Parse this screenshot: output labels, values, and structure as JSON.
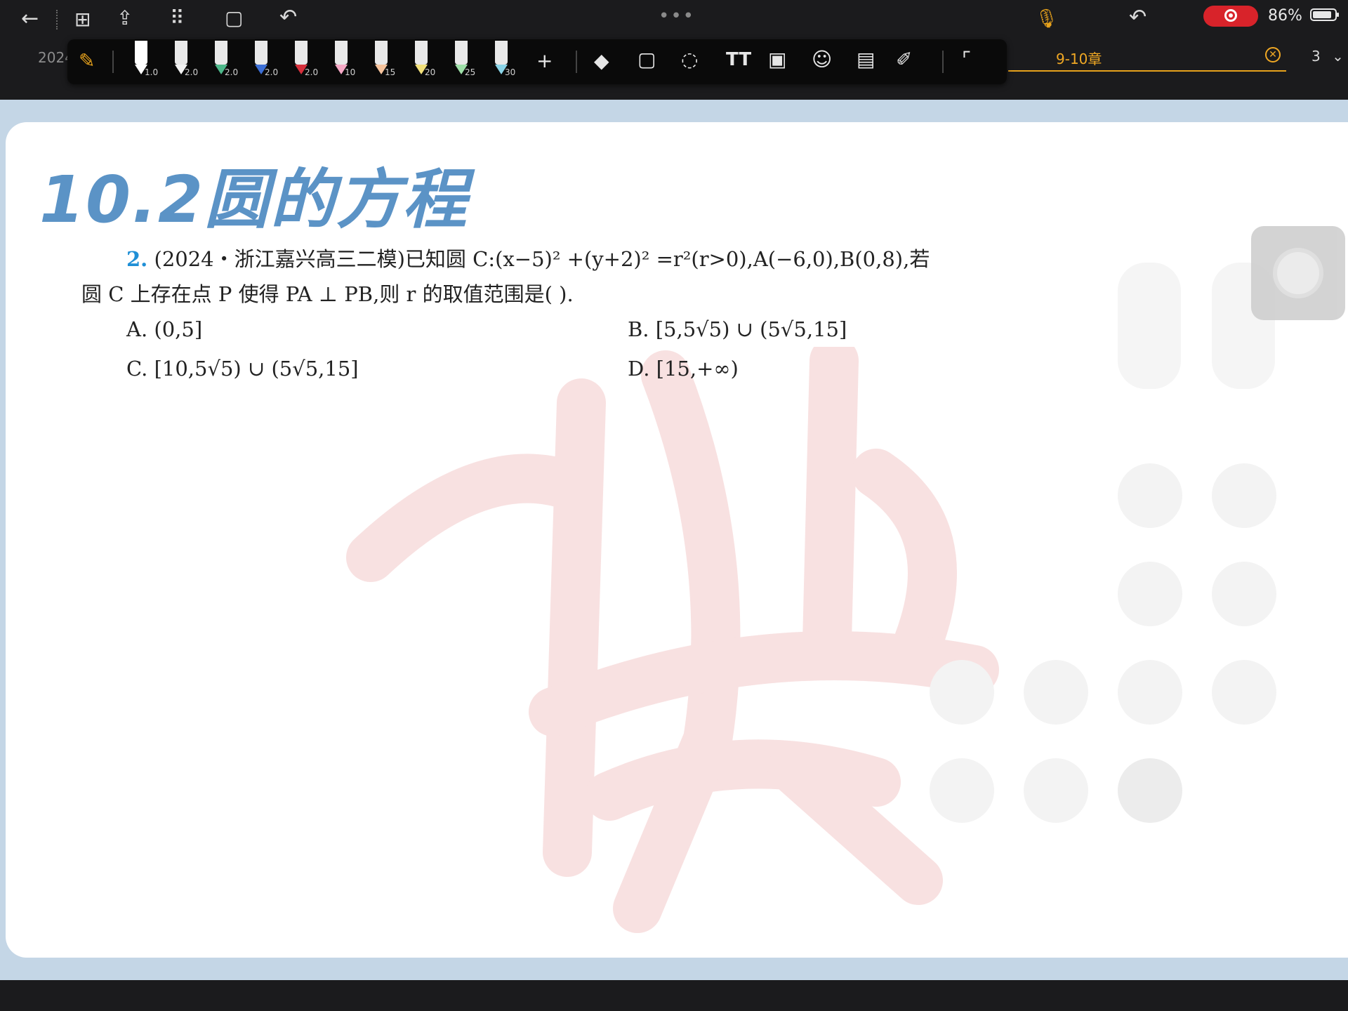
{
  "tabs": {
    "left_tab": "2024",
    "active_tab": "9-10章",
    "page_count": "3"
  },
  "status": {
    "battery": "86%"
  },
  "toolbar": {
    "pen_sizes": [
      "1.0",
      "2.0",
      "2.0",
      "2.0",
      "2.0",
      "10",
      "15",
      "20",
      "25",
      "30"
    ],
    "pen_colors": [
      "#ffffff",
      "#f2f2f2",
      "#4db88a",
      "#3c6fd6",
      "#d7303c",
      "#f6a9c6",
      "#f6c39c",
      "#f2e07a",
      "#9ee0a8",
      "#8ad4e8"
    ],
    "add_label": "+",
    "text_tool_label": "TT"
  },
  "document": {
    "section_title": "10.2圆的方程",
    "question": {
      "number": "2.",
      "line1": "(2024・浙江嘉兴高三二模)已知圆 C:(x−5)² +(y+2)² =r²(r>0),A(−6,0),B(0,8),若",
      "line2": "圆 C 上存在点 P 使得 PA ⊥ PB,则 r 的取值范围是(      )."
    },
    "options": {
      "a": "A. (0,5]",
      "b": "B. [5,5√5) ∪ (5√5,15]",
      "c": "C. [10,5√5) ∪ (5√5,15]",
      "d": "D. [15,+∞)"
    },
    "watermark_color": "#f3c9c9"
  }
}
